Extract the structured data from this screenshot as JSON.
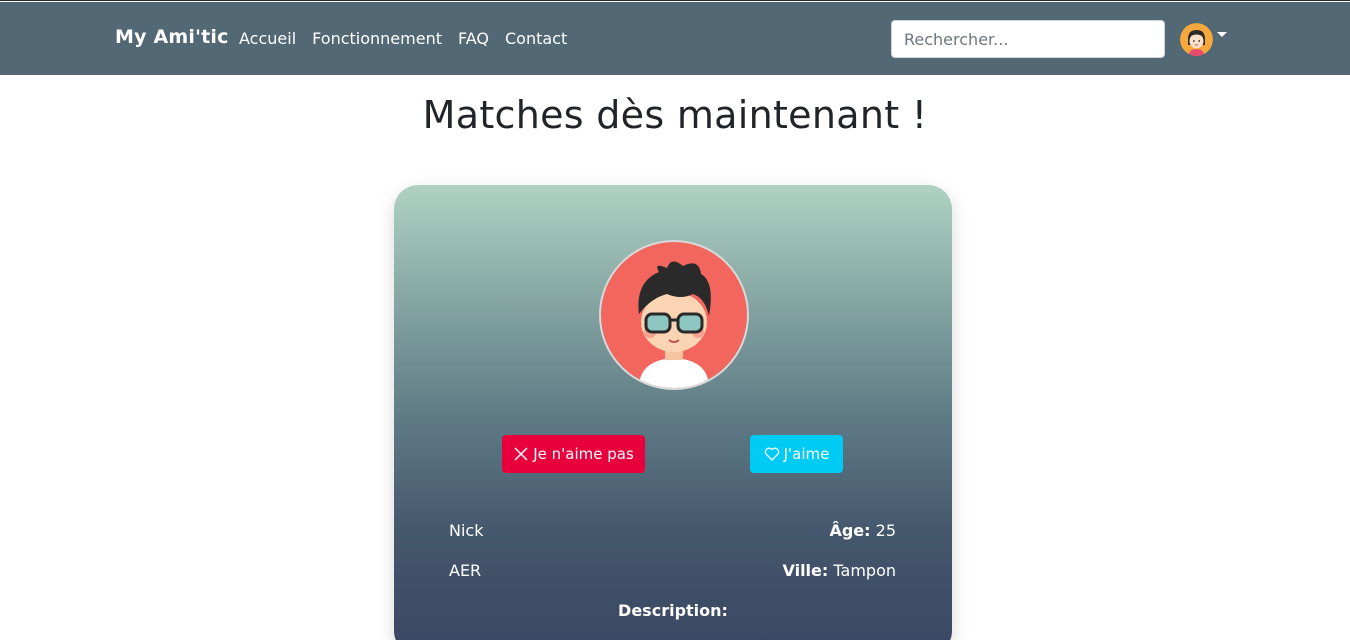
{
  "nav": {
    "brand": "My Ami'tic",
    "links": [
      "Accueil",
      "Fonctionnement",
      "FAQ",
      "Contact"
    ],
    "search_placeholder": "Rechercher...",
    "avatar_icon": "user-avatar-icon"
  },
  "page": {
    "title": "Matches dès maintenant !"
  },
  "profile": {
    "name": "Nick",
    "group": "AER",
    "age_label": "Âge:",
    "age_value": "25",
    "city_label": "Ville:",
    "city_value": "Tampon",
    "description_label": "Description:"
  },
  "actions": {
    "dislike_label": "Je n'aime pas",
    "like_label": "J'aime",
    "dislike_icon": "x-icon",
    "like_icon": "heart-icon"
  },
  "colors": {
    "navbar": "#526874",
    "dislike": "#e8003d",
    "like": "#00cbf5"
  }
}
